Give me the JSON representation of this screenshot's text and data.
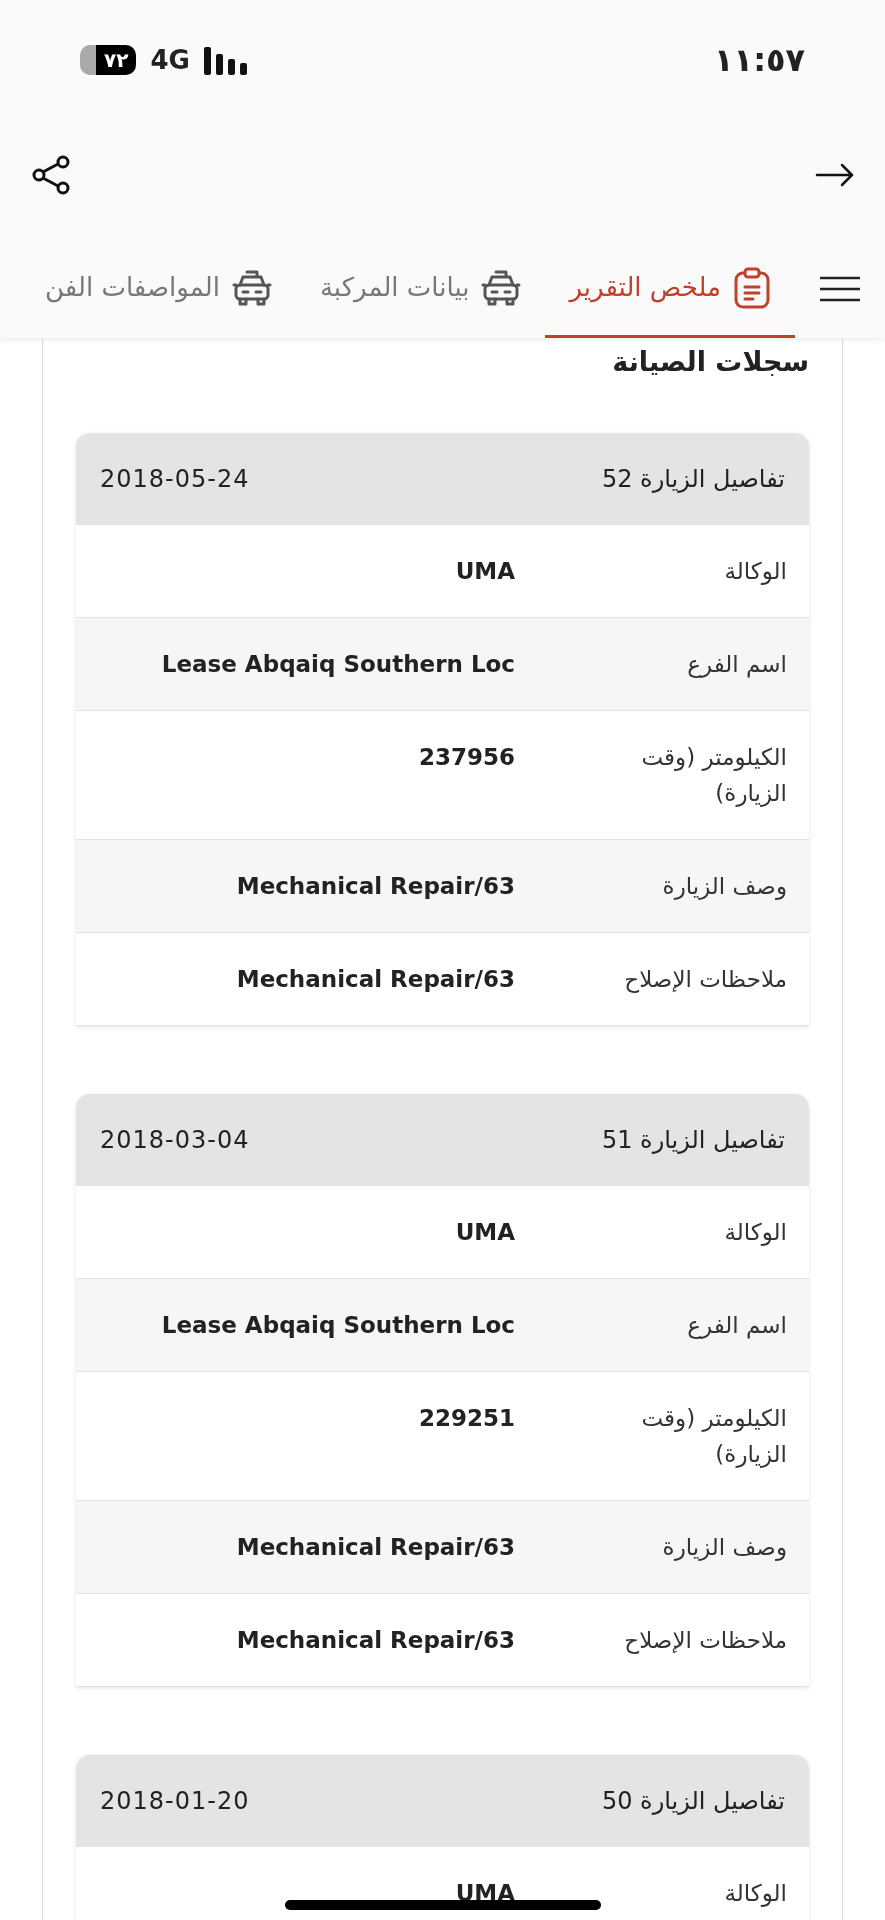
{
  "status_bar": {
    "time": "١١:٥٧",
    "network": "4G",
    "battery": "٧٢"
  },
  "tabs": [
    {
      "label": "ملخص التقرير",
      "selected": true,
      "kind": "clipboard"
    },
    {
      "label": "بيانات المركبة",
      "selected": false,
      "kind": "car"
    },
    {
      "label": "المواصفات الفن",
      "selected": false,
      "kind": "car"
    }
  ],
  "section_title": "سجلات الصيانة",
  "visits": [
    {
      "title": "تفاصيل الزيارة 52",
      "date": "2018-05-24",
      "rows": [
        {
          "label": "الوكالة",
          "value": "UMA"
        },
        {
          "label": "اسم الفرع",
          "value": "Lease Abqaiq Southern Loc"
        },
        {
          "label": "الكيلومتر (وقت الزيارة)",
          "value": "237956"
        },
        {
          "label": "وصف الزيارة",
          "value": "Mechanical Repair/63"
        },
        {
          "label": "ملاحظات الإصلاح",
          "value": "Mechanical Repair/63"
        }
      ]
    },
    {
      "title": "تفاصيل الزيارة 51",
      "date": "2018-03-04",
      "rows": [
        {
          "label": "الوكالة",
          "value": "UMA"
        },
        {
          "label": "اسم الفرع",
          "value": "Lease Abqaiq Southern Loc"
        },
        {
          "label": "الكيلومتر (وقت الزيارة)",
          "value": "229251"
        },
        {
          "label": "وصف الزيارة",
          "value": "Mechanical Repair/63"
        },
        {
          "label": "ملاحظات الإصلاح",
          "value": "Mechanical Repair/63"
        }
      ]
    },
    {
      "title": "تفاصيل الزيارة 50",
      "date": "2018-01-20",
      "rows": [
        {
          "label": "الوكالة",
          "value": "UMA"
        }
      ]
    }
  ]
}
